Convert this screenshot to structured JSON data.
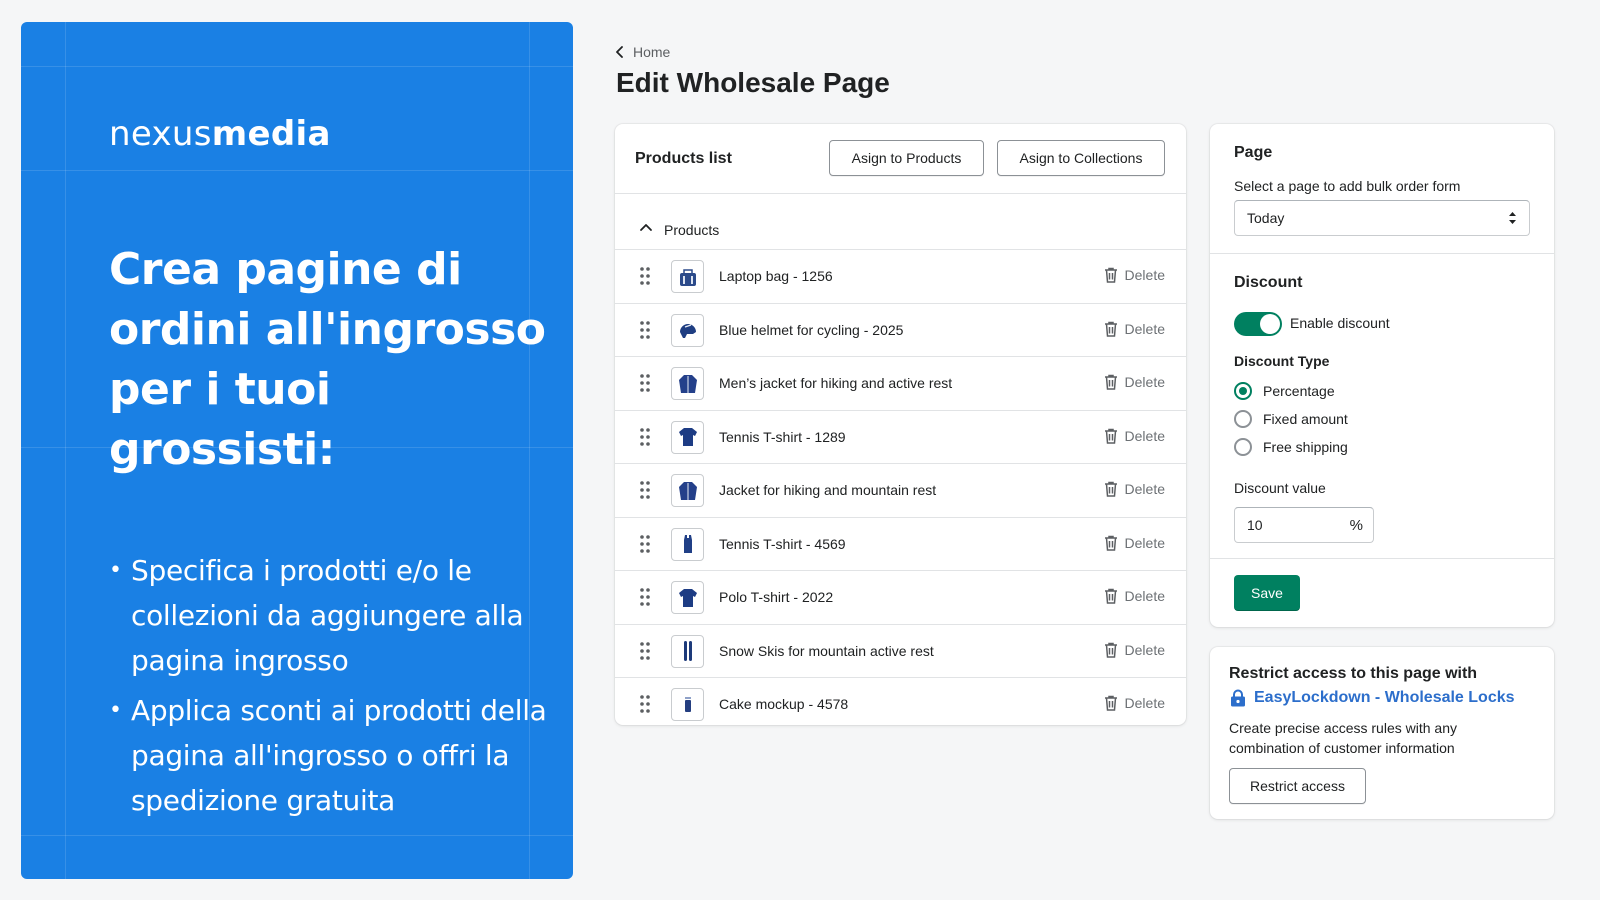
{
  "promo": {
    "logo_light": "nexus",
    "logo_bold": "media",
    "headline": "Crea pagine di ordini all'ingrosso per i tuoi grossisti:",
    "bullets": [
      "Specifica i prodotti e/o le collezioni da aggiungere alla pagina ingrosso",
      "Applica sconti ai prodotti della pagina all'ingrosso o offri la spedizione gratuita"
    ],
    "color": "#1a80e4"
  },
  "header": {
    "back_label": "Home",
    "title": "Edit Wholesale Page"
  },
  "products_card": {
    "title": "Products list",
    "assign_products_label": "Asign to Products",
    "assign_collections_label": "Asign to Collections",
    "group_label": "Products",
    "delete_label": "Delete",
    "items": [
      {
        "name": "Laptop bag - 1256",
        "icon": "bag-icon"
      },
      {
        "name": "Blue helmet for cycling - 2025",
        "icon": "helmet-icon"
      },
      {
        "name": "Men’s jacket for hiking and active rest",
        "icon": "jacket-icon"
      },
      {
        "name": "Tennis T-shirt - 1289",
        "icon": "tshirt-icon"
      },
      {
        "name": "Jacket for hiking and mountain rest",
        "icon": "jacket-icon"
      },
      {
        "name": "Tennis T-shirt - 4569",
        "icon": "tanktop-icon"
      },
      {
        "name": "Polo T-shirt - 2022",
        "icon": "tshirt-icon"
      },
      {
        "name": "Snow Skis for mountain active rest",
        "icon": "skis-icon"
      },
      {
        "name": "Cake mockup - 4578",
        "icon": "cake-icon"
      }
    ]
  },
  "page_section": {
    "title": "Page",
    "label": "Select a page to add bulk order form",
    "selected": "Today"
  },
  "discount_section": {
    "title": "Discount",
    "toggle_label": "Enable discount",
    "toggle_on": true,
    "type_label": "Discount Type",
    "options": [
      "Percentage",
      "Fixed amount",
      "Free shipping"
    ],
    "selected_option": "Percentage",
    "value_label": "Discount value",
    "value": "10",
    "unit": "%",
    "save_label": "Save",
    "accent": "#008060"
  },
  "restrict_card": {
    "title": "Restrict access to this page with",
    "link_label": "EasyLockdown - Wholesale Locks",
    "description": "Create precise access rules with any combination of customer information",
    "button_label": "Restrict access",
    "link_color": "#2c6ecb"
  }
}
